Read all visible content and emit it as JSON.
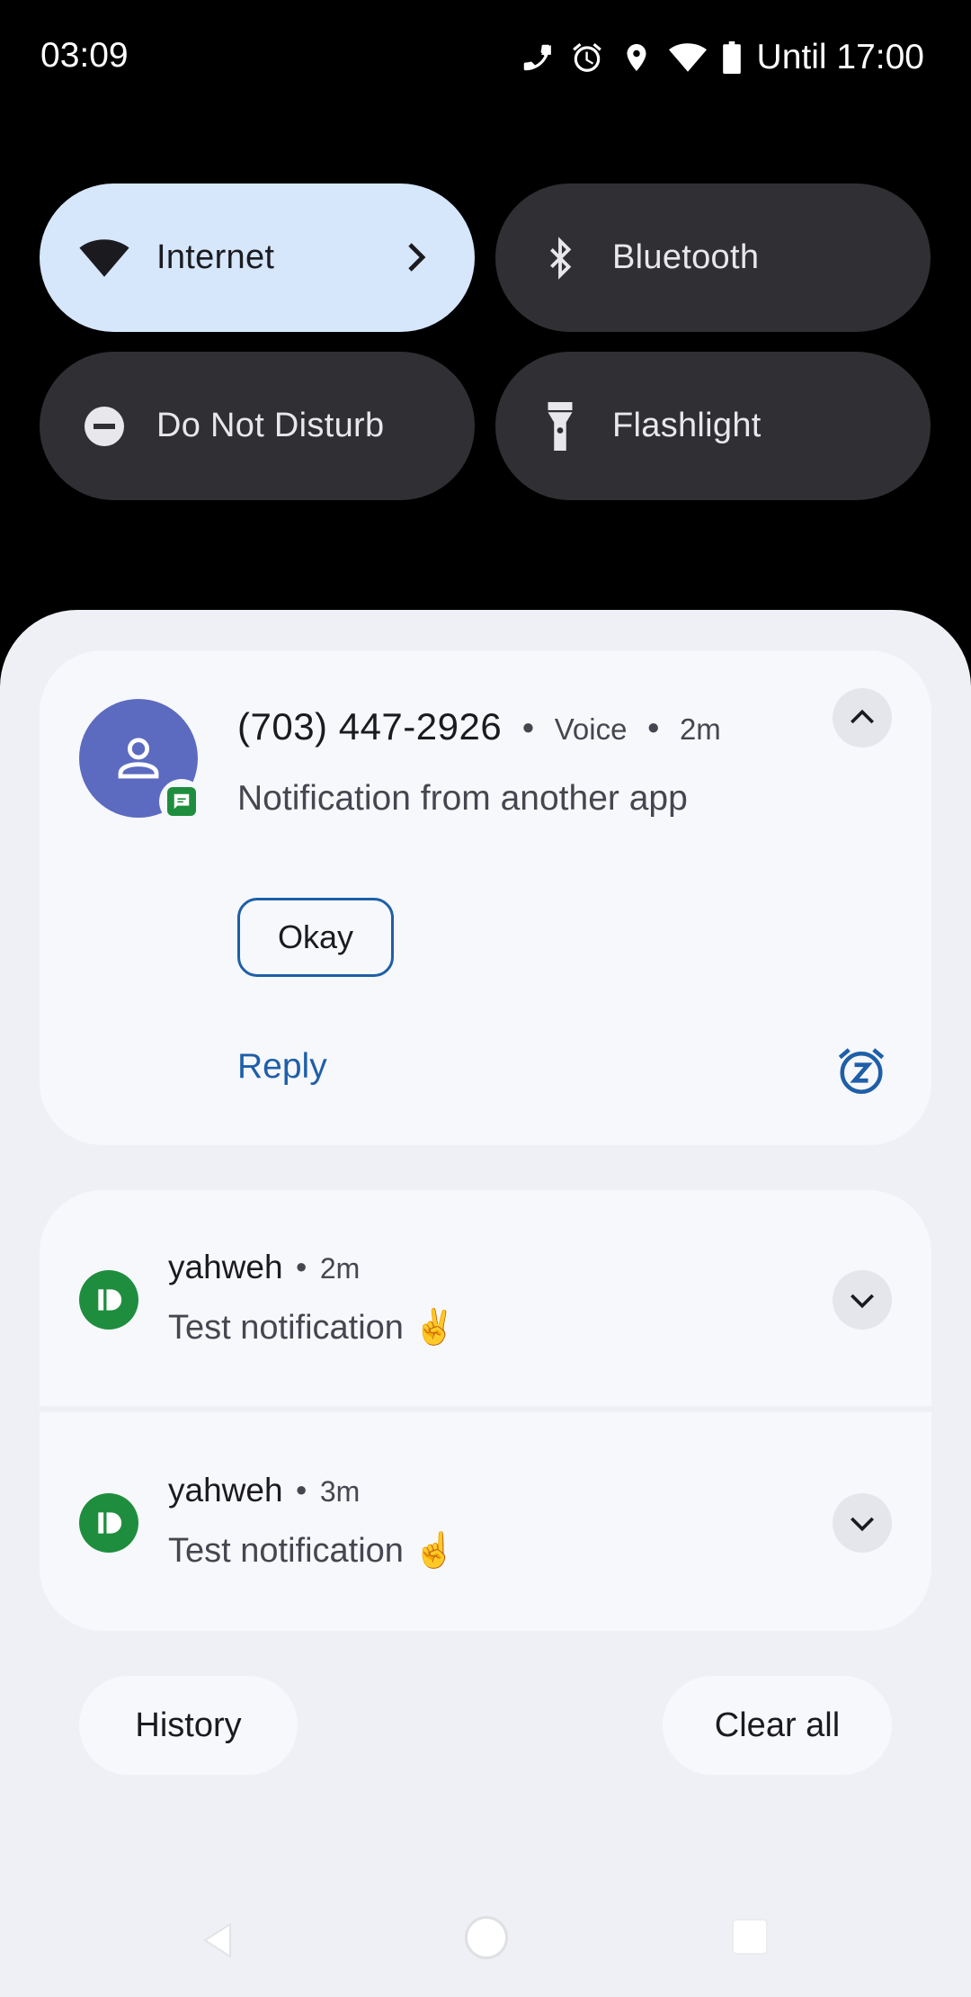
{
  "status_bar": {
    "time": "03:09",
    "icons": [
      "wifi-calling-icon",
      "alarm-icon",
      "location-icon",
      "wifi-icon",
      "battery-icon"
    ],
    "battery_label": "Until 17:00"
  },
  "quick_settings": {
    "tiles": [
      {
        "label": "Internet",
        "icon": "wifi-icon",
        "active": true,
        "has_chevron": true
      },
      {
        "label": "Bluetooth",
        "icon": "bluetooth-icon",
        "active": false
      },
      {
        "label": "Do Not Disturb",
        "icon": "do-not-disturb-icon",
        "active": false
      },
      {
        "label": "Flashlight",
        "icon": "flashlight-icon",
        "active": false
      }
    ]
  },
  "notifications": {
    "primary": {
      "title": "(703) 447-2926",
      "app": "Voice",
      "time": "2m",
      "text": "Notification from another app",
      "action_button": "Okay",
      "reply_label": "Reply"
    },
    "items": [
      {
        "title": "yahweh",
        "time": "2m",
        "text": "Test notification ✌️"
      },
      {
        "title": "yahweh",
        "time": "3m",
        "text": "Test notification ☝️"
      }
    ]
  },
  "footer": {
    "history_label": "History",
    "clear_all_label": "Clear all"
  },
  "colors": {
    "accent": "#1e5fa8",
    "active_tile": "#d6e6fb",
    "inactive_tile": "#303034",
    "shade_bg": "#eff0f5",
    "card_bg": "#f7f8fc",
    "avatar_bg": "#5c6bc0",
    "app_icon_green": "#1e8e3e"
  }
}
